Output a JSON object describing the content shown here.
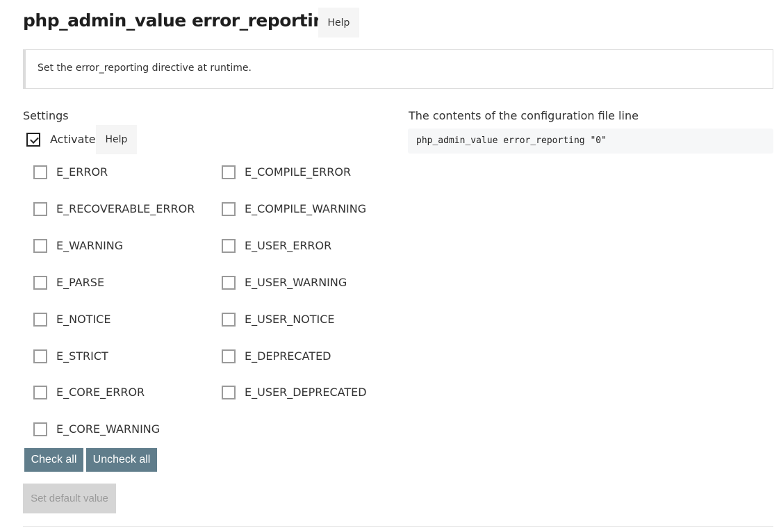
{
  "header": {
    "title": "php_admin_value error_reporting",
    "help_label": "Help"
  },
  "description": "Set the error_reporting directive at runtime.",
  "settings": {
    "label": "Settings",
    "activate": {
      "label": "Activate",
      "checked": true,
      "help_label": "Help"
    },
    "options_left": [
      {
        "label": "E_ERROR",
        "checked": false
      },
      {
        "label": "E_RECOVERABLE_ERROR",
        "checked": false
      },
      {
        "label": "E_WARNING",
        "checked": false
      },
      {
        "label": "E_PARSE",
        "checked": false
      },
      {
        "label": "E_NOTICE",
        "checked": false
      },
      {
        "label": "E_STRICT",
        "checked": false
      },
      {
        "label": "E_CORE_ERROR",
        "checked": false
      },
      {
        "label": "E_CORE_WARNING",
        "checked": false
      }
    ],
    "options_right": [
      {
        "label": "E_COMPILE_ERROR",
        "checked": false
      },
      {
        "label": "E_COMPILE_WARNING",
        "checked": false
      },
      {
        "label": "E_USER_ERROR",
        "checked": false
      },
      {
        "label": "E_USER_WARNING",
        "checked": false
      },
      {
        "label": "E_USER_NOTICE",
        "checked": false
      },
      {
        "label": "E_DEPRECATED",
        "checked": false
      },
      {
        "label": "E_USER_DEPRECATED",
        "checked": false
      }
    ],
    "check_all_label": "Check all",
    "uncheck_all_label": "Uncheck all",
    "set_default_label": "Set default value"
  },
  "config": {
    "label": "The contents of the configuration file line",
    "line": "php_admin_value error_reporting \"0\""
  },
  "colors": {
    "primary_button": "#607d8b",
    "disabled_button": "#d5d5d5",
    "help_button_bg": "#f5f5f5"
  }
}
